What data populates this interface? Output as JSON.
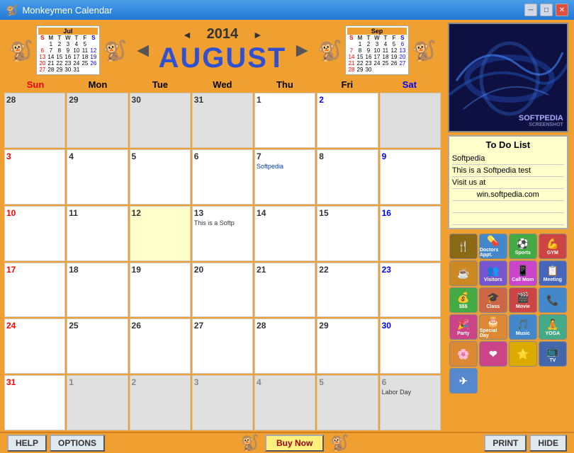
{
  "titleBar": {
    "title": "Monkeymen Calendar",
    "minimizeLabel": "─",
    "maximizeLabel": "□",
    "closeLabel": "✕"
  },
  "header": {
    "year": "2014",
    "month": "AUGUST",
    "prevYearLabel": "◄",
    "nextYearLabel": "►",
    "prevMonthLabel": "◄",
    "nextMonthLabel": "►"
  },
  "miniCalJul": {
    "title": "Jul",
    "headers": [
      "S",
      "M",
      "T",
      "W",
      "T",
      "F",
      "S"
    ],
    "rows": [
      [
        "",
        "1",
        "2",
        "3",
        "4",
        "5",
        ""
      ],
      [
        "6",
        "7",
        "8",
        "9",
        "10",
        "11",
        "12"
      ],
      [
        "13",
        "14",
        "15",
        "16",
        "17",
        "18",
        "19"
      ],
      [
        "20",
        "21",
        "22",
        "23",
        "24",
        "25",
        "26"
      ],
      [
        "27",
        "28",
        "29",
        "30",
        "31",
        "",
        ""
      ]
    ]
  },
  "miniCalSep": {
    "title": "Sep",
    "headers": [
      "S",
      "M",
      "T",
      "W",
      "T",
      "F",
      "S"
    ],
    "rows": [
      [
        "",
        "1",
        "2",
        "3",
        "4",
        "5",
        "6"
      ],
      [
        "7",
        "8",
        "9",
        "10",
        "11",
        "12",
        "13"
      ],
      [
        "14",
        "15",
        "16",
        "17",
        "18",
        "19",
        "20"
      ],
      [
        "21",
        "22",
        "23",
        "24",
        "25",
        "26",
        "27"
      ],
      [
        "28",
        "29",
        "30",
        "",
        "",
        "",
        ""
      ]
    ]
  },
  "dayHeaders": [
    "Sun",
    "Mon",
    "Tue",
    "Wed",
    "Thu",
    "Fri",
    "Sat"
  ],
  "calendarCells": [
    {
      "day": "28",
      "otherMonth": true
    },
    {
      "day": "29",
      "otherMonth": true
    },
    {
      "day": "30",
      "otherMonth": true
    },
    {
      "day": "31",
      "otherMonth": true
    },
    {
      "day": "1",
      "weekend": false
    },
    {
      "day": "2",
      "weekend": "sat"
    },
    {
      "day": "",
      "empty": true
    },
    {
      "day": "3",
      "weekend": "sun"
    },
    {
      "day": "4"
    },
    {
      "day": "5"
    },
    {
      "day": "6"
    },
    {
      "day": "7",
      "event": "Softpedia"
    },
    {
      "day": "8"
    },
    {
      "day": "9"
    },
    {
      "day": "10",
      "weekend": "sun"
    },
    {
      "day": "11"
    },
    {
      "day": "12",
      "highlighted": true
    },
    {
      "day": "13",
      "note": "This is a Softp"
    },
    {
      "day": "14"
    },
    {
      "day": "15"
    },
    {
      "day": "16"
    },
    {
      "day": "17",
      "weekend": "sun"
    },
    {
      "day": "18"
    },
    {
      "day": "19"
    },
    {
      "day": "20"
    },
    {
      "day": "21"
    },
    {
      "day": "22"
    },
    {
      "day": "23"
    },
    {
      "day": "24",
      "weekend": "sun"
    },
    {
      "day": "25"
    },
    {
      "day": "26"
    },
    {
      "day": "27"
    },
    {
      "day": "28"
    },
    {
      "day": "29"
    },
    {
      "day": "30"
    },
    {
      "day": "31",
      "weekend": "sun"
    },
    {
      "day": "1",
      "otherMonth": true
    },
    {
      "day": "2",
      "otherMonth": true
    },
    {
      "day": "3",
      "otherMonth": true
    },
    {
      "day": "4",
      "otherMonth": true
    },
    {
      "day": "5",
      "otherMonth": true
    },
    {
      "day": "6",
      "otherMonth": true,
      "note": "Labor Day"
    }
  ],
  "todoList": {
    "title": "To Do List",
    "items": [
      "Softpedia",
      "This is a Softpedia test",
      "Visit us at",
      "win.softpedia.com",
      "",
      ""
    ]
  },
  "categoryButtons": [
    {
      "label": "Dinner",
      "color": "#8b6914",
      "icon": "🍴"
    },
    {
      "label": "Doctors Appt.",
      "color": "#4488cc",
      "icon": "💊"
    },
    {
      "label": "Sports",
      "color": "#44aa44",
      "icon": "⚽"
    },
    {
      "label": "GYM",
      "color": "#cc4444",
      "icon": "💪"
    },
    {
      "label": "",
      "color": "#cc8822",
      "icon": "☕"
    },
    {
      "label": "Visitors",
      "color": "#7755cc",
      "icon": "👥"
    },
    {
      "label": "Call Mom",
      "color": "#cc44cc",
      "icon": "📱"
    },
    {
      "label": "Meeting",
      "color": "#4466bb",
      "icon": "📋"
    },
    {
      "label": "$$$",
      "color": "#44aa44",
      "icon": "💰"
    },
    {
      "label": "Class",
      "color": "#cc6644",
      "icon": "🎓"
    },
    {
      "label": "Movie",
      "color": "#cc4444",
      "icon": "🎬"
    },
    {
      "label": "Call",
      "color": "#4488cc",
      "icon": "📞"
    },
    {
      "label": "Party",
      "color": "#cc4488",
      "icon": "🎉"
    },
    {
      "label": "Special Day",
      "color": "#dd8833",
      "icon": "🎂"
    },
    {
      "label": "Music",
      "color": "#4488cc",
      "icon": "🎵"
    },
    {
      "label": "YOGA",
      "color": "#44aa88",
      "icon": "🧘"
    },
    {
      "label": "",
      "color": "#dd8833",
      "icon": "🌸"
    },
    {
      "label": "",
      "color": "#cc4488",
      "icon": "❤"
    },
    {
      "label": "",
      "color": "#ddaa00",
      "icon": "⭐"
    },
    {
      "label": "TV",
      "color": "#4466aa",
      "icon": "📺"
    },
    {
      "label": "Travel",
      "color": "#5588cc",
      "icon": "✈"
    }
  ],
  "bottomBar": {
    "helpLabel": "HELP",
    "optionsLabel": "OPTIONS",
    "buyNowLabel": "Buy Now",
    "printLabel": "PRINT",
    "hideLabel": "HIDE"
  }
}
